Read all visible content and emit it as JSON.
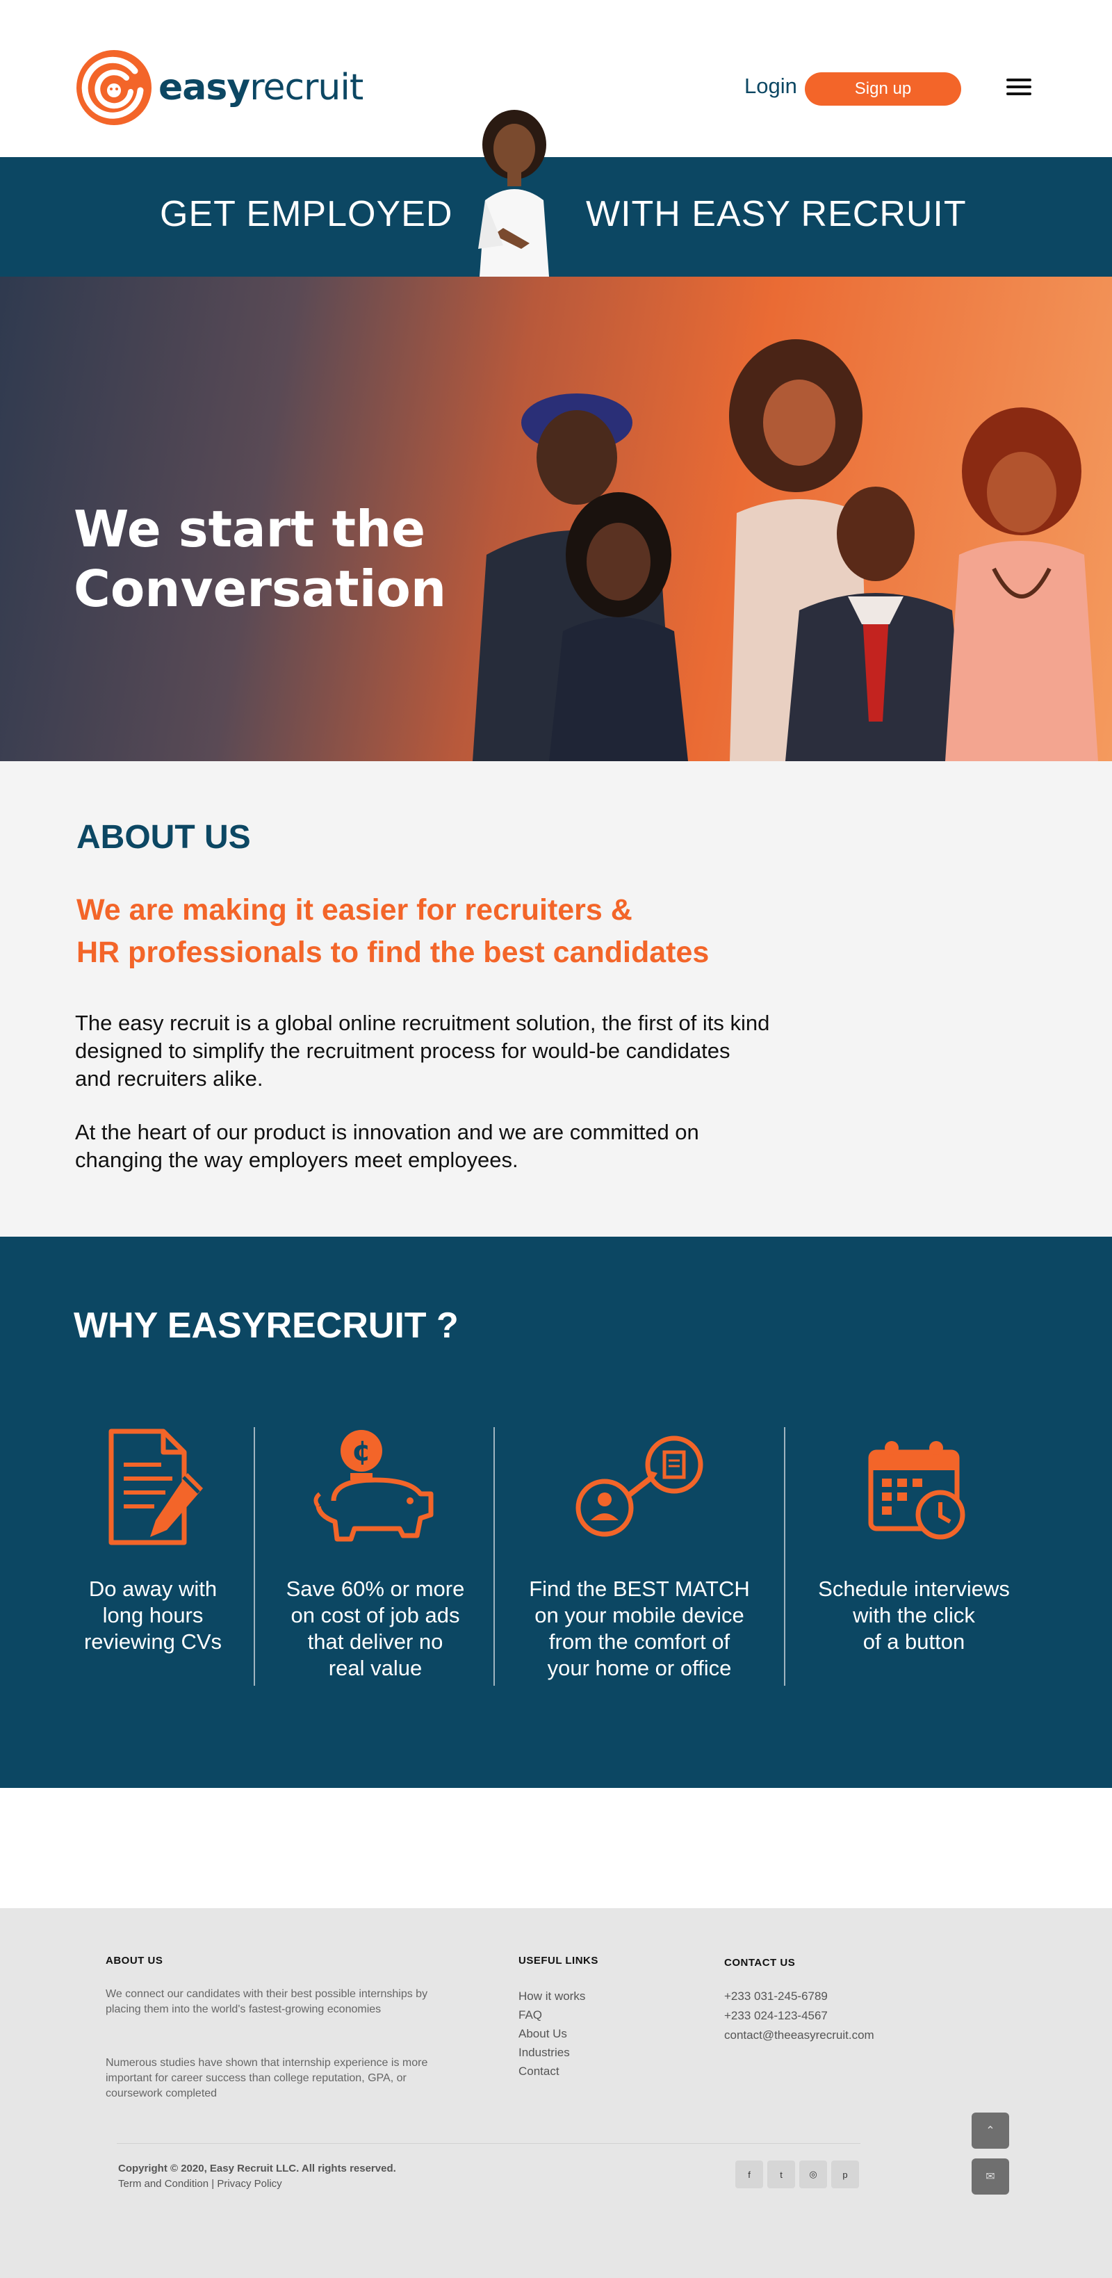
{
  "brand": {
    "name_bold": "easy",
    "name_regular": "recruit",
    "accent_color": "#f36529",
    "primary_color": "#0c4763"
  },
  "nav": {
    "login": "Login",
    "signup": "Sign up",
    "menu_icon": "hamburger-menu-icon"
  },
  "banner": {
    "left_text": "GET EMPLOYED",
    "right_text": "WITH EASY RECRUIT"
  },
  "hero": {
    "title_line1": "We start the",
    "title_line2": "Conversation"
  },
  "about": {
    "heading_bold": "ABOUT",
    "heading_regular": " US",
    "subheading_line1": "We are making it easier for  recruiters &",
    "subheading_line2": "HR professionals to find the best candidates",
    "paragraph1": "The easy recruit is a global online recruitment solution, the first of its kind designed to simplify the recruitment process for would-be candidates and recruiters alike.",
    "paragraph2": "At the heart of our product is innovation and we are committed on changing the way employers meet employees."
  },
  "why": {
    "heading_bold": "WHY EASY",
    "heading_regular": "RECRUIT ?",
    "features": [
      {
        "icon": "document-pen-icon",
        "text": "Do away with\nlong hours\nreviewing CVs"
      },
      {
        "icon": "piggy-bank-icon",
        "text": "Save 60% or more\non cost of job ads\nthat deliver no\nreal value"
      },
      {
        "icon": "match-connection-icon",
        "text": "Find the BEST MATCH\non  your mobile device\nfrom the comfort of\nyour home or office"
      },
      {
        "icon": "calendar-clock-icon",
        "text": "Schedule interviews\nwith the click\nof a button"
      }
    ]
  },
  "footer": {
    "about_title": "ABOUT US",
    "about_p1": "We connect our candidates with their best possible internships by placing them into the world's fastest-growing economies",
    "about_p2": "Numerous studies have shown that internship experience is more important for career success than college reputation, GPA, or coursework completed",
    "links_title": "USEFUL LINKS",
    "links": [
      "How it works",
      "FAQ",
      "About Us",
      "Industries",
      "Contact"
    ],
    "contact_title": "CONTACT US",
    "contact": [
      "+233 031-245-6789",
      "+233 024-123-4567",
      "contact@theeasyrecruit.com"
    ],
    "copyright": "Copyright © 2020, Easy Recruit LLC. All rights reserved.",
    "terms": "Term and Condition",
    "terms_sep": " | ",
    "privacy": "Privacy Policy",
    "socials": [
      {
        "icon": "facebook-icon",
        "glyph": "f"
      },
      {
        "icon": "twitter-icon",
        "glyph": "t"
      },
      {
        "icon": "instagram-icon",
        "glyph": "◎"
      },
      {
        "icon": "pinterest-icon",
        "glyph": "p"
      }
    ],
    "side_buttons": [
      {
        "icon": "scroll-up-icon",
        "glyph": "⌃"
      },
      {
        "icon": "mail-icon",
        "glyph": "✉"
      }
    ]
  }
}
